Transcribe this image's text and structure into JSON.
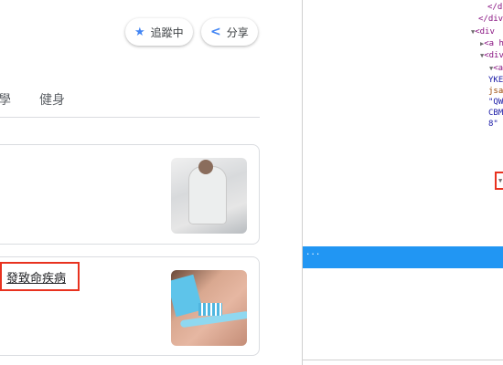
{
  "header": {
    "follow_label": "追蹤中",
    "share_label": "分享"
  },
  "tabs": [
    {
      "label": "學"
    },
    {
      "label": "健身"
    }
  ],
  "articles": [
    {
      "title": ""
    },
    {
      "title": "發致命疾病"
    }
  ],
  "devtools": {
    "lines": [
      {
        "text": "</d",
        "kind": "tag"
      },
      {
        "text": "</div",
        "kind": "tag"
      },
      {
        "text": "<div",
        "kind": "tag",
        "arrow": "▼"
      },
      {
        "text": "<a h",
        "kind": "tag",
        "arrow": "▶"
      },
      {
        "text": "<div",
        "kind": "tag",
        "arrow": "▼"
      },
      {
        "text": "<a",
        "kind": "tag",
        "arrow": "▼"
      },
      {
        "text": "YKE",
        "kind": "val"
      },
      {
        "text": "jsa",
        "kind": "attr"
      },
      {
        "text": "\"QW",
        "kind": "val"
      },
      {
        "text": "CBM",
        "kind": "val"
      },
      {
        "text": "8\"",
        "kind": "val"
      }
    ],
    "selected_label": "...",
    "collapsed_arrow": "▼"
  },
  "colors": {
    "accent": "#4285f4",
    "highlight": "#e8321f",
    "selection": "#2196f3"
  }
}
